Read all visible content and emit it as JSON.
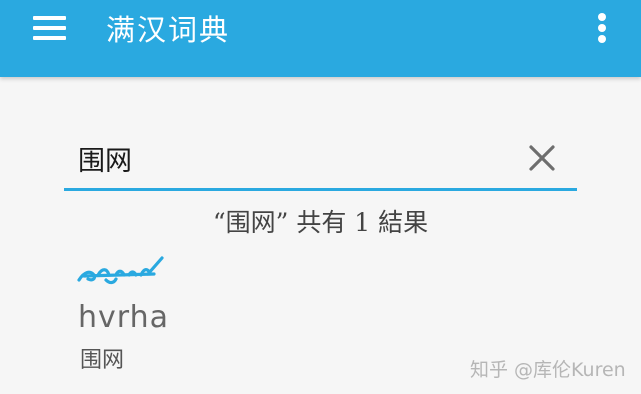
{
  "app_bar": {
    "title": "满汉词典",
    "background_color": "#2aa9e0",
    "menu_icon": "hamburger-menu-icon",
    "overflow_icon": "more-vertical-icon"
  },
  "search": {
    "value": "围网",
    "clear_icon": "close-icon",
    "accent_color": "#2aa9e0"
  },
  "results": {
    "summary": "“围网” 共有 1 結果",
    "items": [
      {
        "manchu": "ᡥᡡᡵᡥᠠ",
        "transliteration": "hvrha",
        "chinese": "围网"
      }
    ]
  },
  "watermark": "知乎 @库伦Kuren"
}
